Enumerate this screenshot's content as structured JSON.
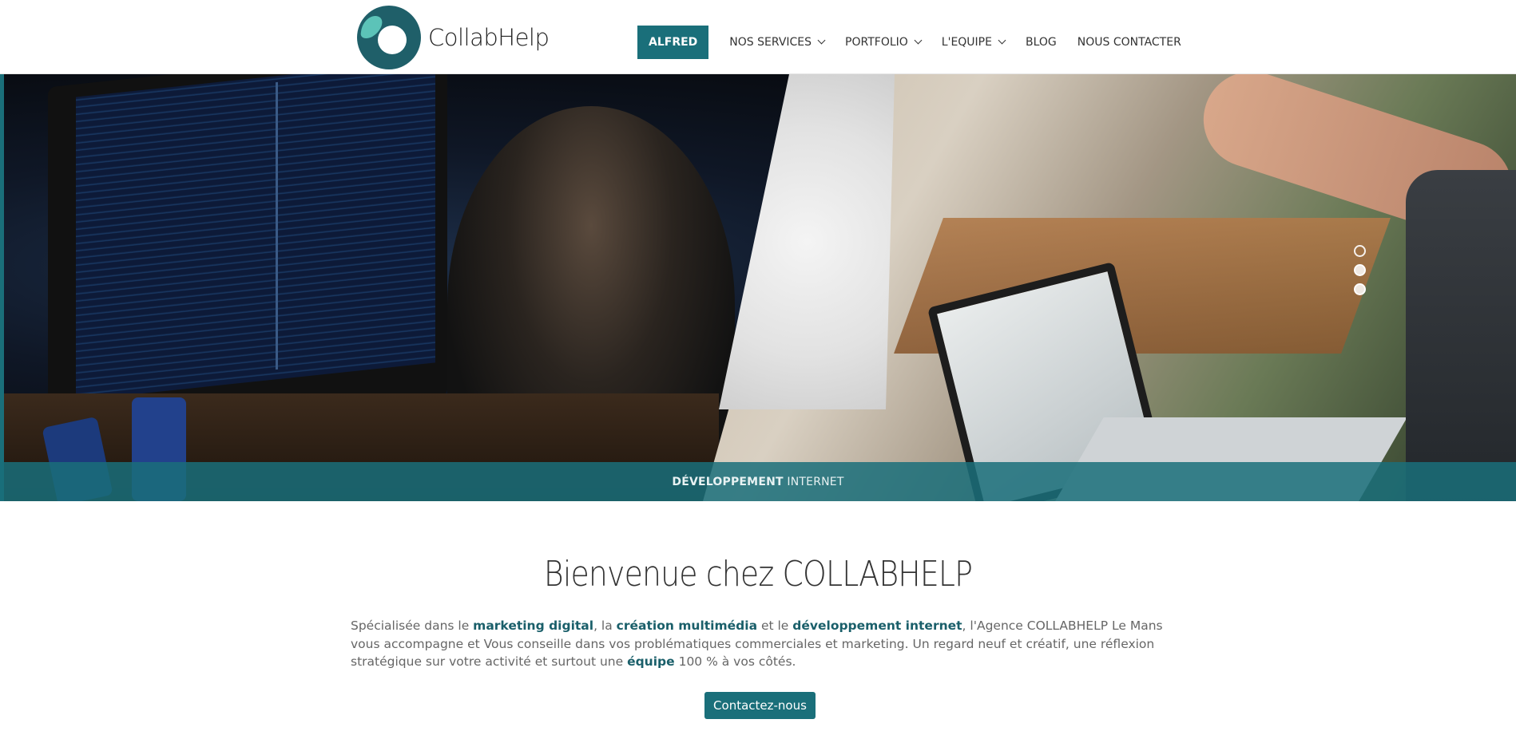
{
  "header": {
    "logo_text": "CollabHelp",
    "nav": [
      {
        "label": "ALFRED",
        "dropdown": false,
        "active": true
      },
      {
        "label": "NOS SERVICES",
        "dropdown": true
      },
      {
        "label": "PORTFOLIO",
        "dropdown": true
      },
      {
        "label": "L'EQUIPE",
        "dropdown": true
      },
      {
        "label": "BLOG",
        "dropdown": false
      },
      {
        "label": "NOUS CONTACTER",
        "dropdown": false
      }
    ]
  },
  "hero": {
    "caption_bold": "DÉVELOPPEMENT",
    "caption_rest": " INTERNET",
    "slides_count": 3,
    "active_slide": 1
  },
  "intro": {
    "title": "Bienvenue chez COLLABHELP",
    "p1": "Spécialisée dans le ",
    "hl1": "marketing digital",
    "p2": ", la ",
    "hl2": "création multimédia",
    "p3": " et le ",
    "hl3": "développement internet",
    "p4": ", l'Agence COLLABHELP Le Mans vous accompagne et Vous conseille dans vos problématiques commerciales et marketing. Un regard neuf et créatif, une réflexion stratégique sur votre activité et surtout une ",
    "hl4": "équipe",
    "p5": " 100 % à vos côtés.",
    "cta_label": "Contactez-nous"
  },
  "colors": {
    "brand": "#1a6f7a",
    "brand_light": "#5cc3b8"
  }
}
